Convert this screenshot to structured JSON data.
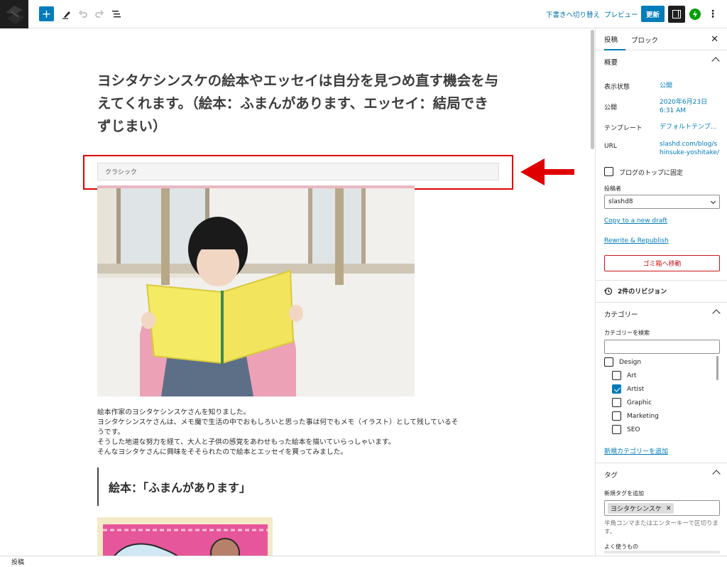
{
  "toolbar": {
    "add_icon": "plus-icon",
    "draft_switch": "下書きへ切り替え",
    "preview": "プレビュー",
    "update": "更新"
  },
  "post": {
    "title": "ヨシタケシンスケの絵本やエッセイは自分を見つめ直す機会を与えてくれます。（絵本：ふまんがあります、エッセイ：結局できずじまい）",
    "classic_label": "クラシック",
    "paragraphs": [
      "絵本作家のヨシタケシンスケさんを知りました。",
      "ヨシタケシンスケさんは、メモ魔で生活の中でおもしろいと思った事は何でもメモ（イラスト）として残しているそ",
      "うです。",
      "そうした地道な努力を経て、大人と子供の感覚をあわせもった絵本を描いていらっしゃいます。",
      "そんなヨシタケさんに興味をそそられたので絵本とエッセイを買ってみました。"
    ],
    "subheading": "絵本：「ふまんがあります」"
  },
  "sidebar": {
    "tabs": [
      "投稿",
      "ブロック"
    ],
    "summary": {
      "title": "概要",
      "visibility_label": "表示状態",
      "visibility_value": "公開",
      "publish_label": "公開",
      "publish_value": "2020年6月23日 6:31 AM",
      "template_label": "テンプレート",
      "template_value": "デフォルトテンプ…",
      "url_label": "URL",
      "url_value": "slashd.com/blog/shinsuke-yoshitake/",
      "sticky_label": "ブログのトップに固定",
      "author_label": "投稿者",
      "author_value": "slashd8",
      "copy_draft": "Copy to a new draft",
      "rewrite": "Rewrite & Republish",
      "trash": "ゴミ箱へ移動"
    },
    "revisions": "2件のリビジョン",
    "categories": {
      "title": "カテゴリー",
      "search_label": "カテゴリーを検索",
      "items": [
        {
          "label": "Design",
          "checked": false
        },
        {
          "label": "Art",
          "checked": false
        },
        {
          "label": "Artist",
          "checked": true
        },
        {
          "label": "Graphic",
          "checked": false
        },
        {
          "label": "Marketing",
          "checked": false
        },
        {
          "label": "SEO",
          "checked": false
        }
      ],
      "add_new": "新規カテゴリーを追加"
    },
    "tags": {
      "title": "タグ",
      "add_label": "新規タグを追加",
      "chip": "ヨシタケシンスケ",
      "help": "半角コンマまたはエンターキーで区切ります。",
      "frequent": "よく使うもの"
    }
  },
  "statusbar": {
    "breadcrumb": "投稿"
  },
  "colors": {
    "accent": "#007cba",
    "danger": "#cc1818",
    "highlight": "#e00000"
  }
}
